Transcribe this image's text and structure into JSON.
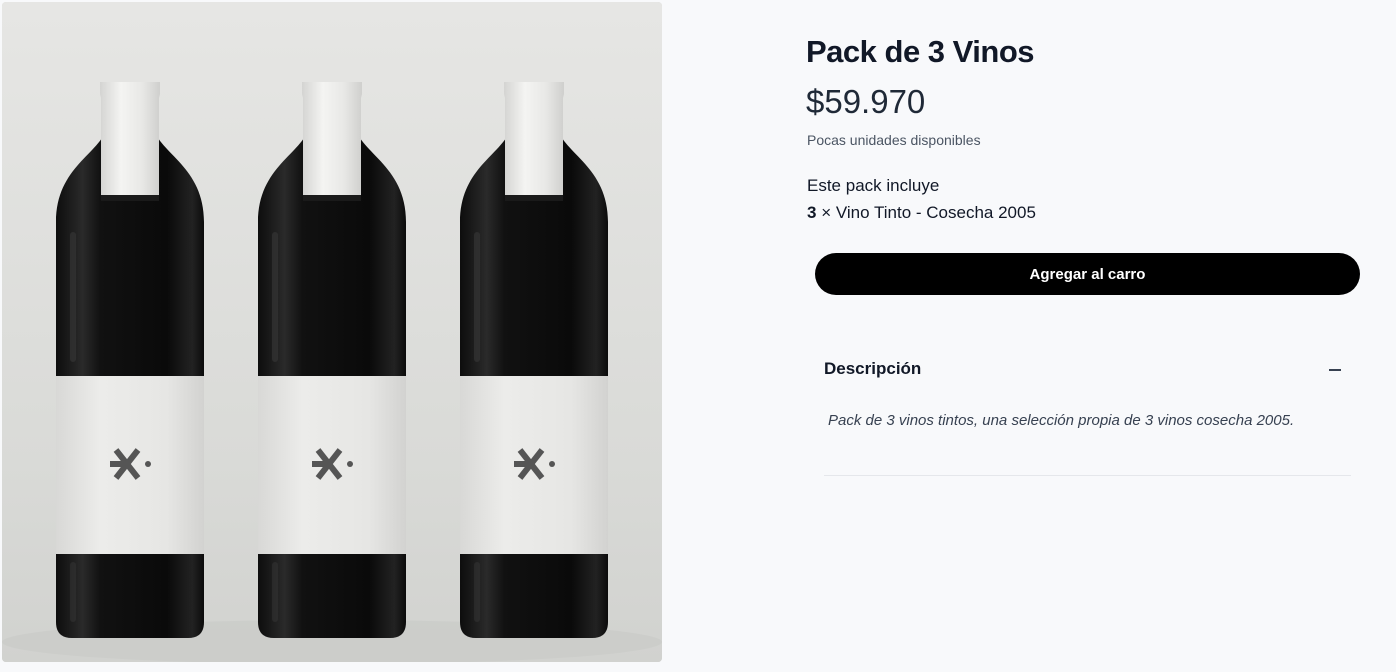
{
  "product": {
    "title": "Pack de 3 Vinos",
    "price": "$59.970",
    "stock_note": "Pocas unidades disponibles",
    "image_icon": "wine-bottles-photo"
  },
  "pack": {
    "heading": "Este pack incluye",
    "items": [
      {
        "quantity": "3",
        "separator": "×",
        "name": "Vino Tinto - Cosecha 2005"
      }
    ]
  },
  "actions": {
    "add_to_cart_label": "Agregar al carro"
  },
  "description": {
    "title": "Descripción",
    "toggle_icon": "minus-icon",
    "expanded": true,
    "text": "Pack de 3 vinos tintos, una selección propia de 3 vinos cosecha 2005."
  },
  "colors": {
    "button_bg": "#000000",
    "button_text": "#ffffff",
    "page_bg": "#f8f9fb"
  }
}
